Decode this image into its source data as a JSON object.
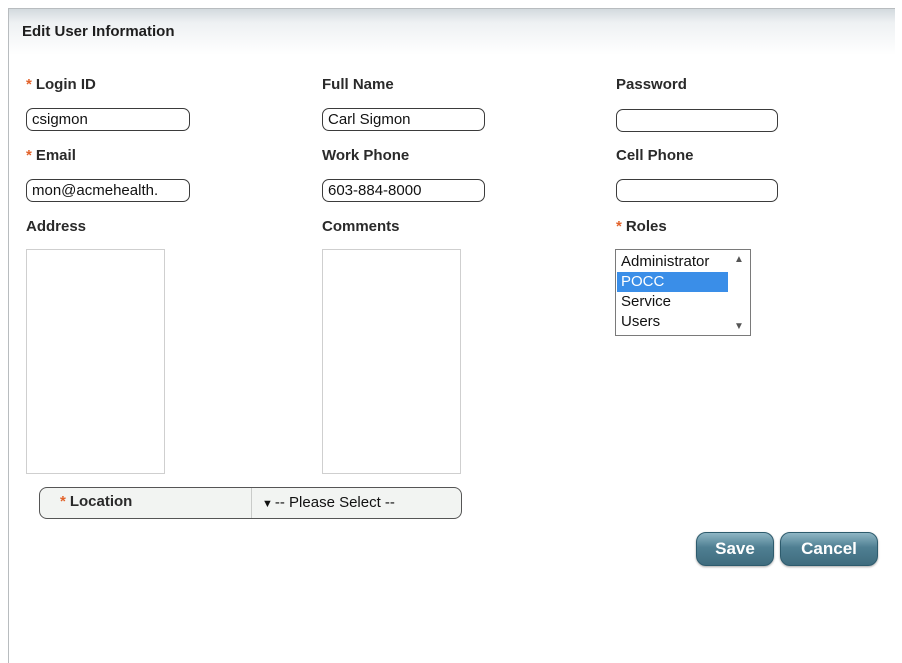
{
  "title": "Edit User Information",
  "required_mark": "*",
  "fields": {
    "login_id": {
      "label": "Login ID",
      "value": "csigmon"
    },
    "full_name": {
      "label": "Full Name",
      "value": "Carl Sigmon"
    },
    "password": {
      "label": "Password",
      "value": ""
    },
    "email": {
      "label": "Email",
      "value": "mon@acmehealth."
    },
    "work_phone": {
      "label": "Work Phone",
      "value": "603-884-8000"
    },
    "cell_phone": {
      "label": "Cell Phone",
      "value": ""
    },
    "address": {
      "label": "Address",
      "value": ""
    },
    "comments": {
      "label": "Comments",
      "value": ""
    },
    "roles": {
      "label": "Roles",
      "options": [
        "Administrator",
        "POCC",
        "Service",
        "Users"
      ],
      "selected": "POCC"
    }
  },
  "location": {
    "label": "Location",
    "selected": "-- Please Select --"
  },
  "buttons": {
    "save": "Save",
    "cancel": "Cancel"
  },
  "colors": {
    "required": "#e2622a",
    "button": "#4f7f92",
    "selected_option": "#3a8ee8"
  }
}
